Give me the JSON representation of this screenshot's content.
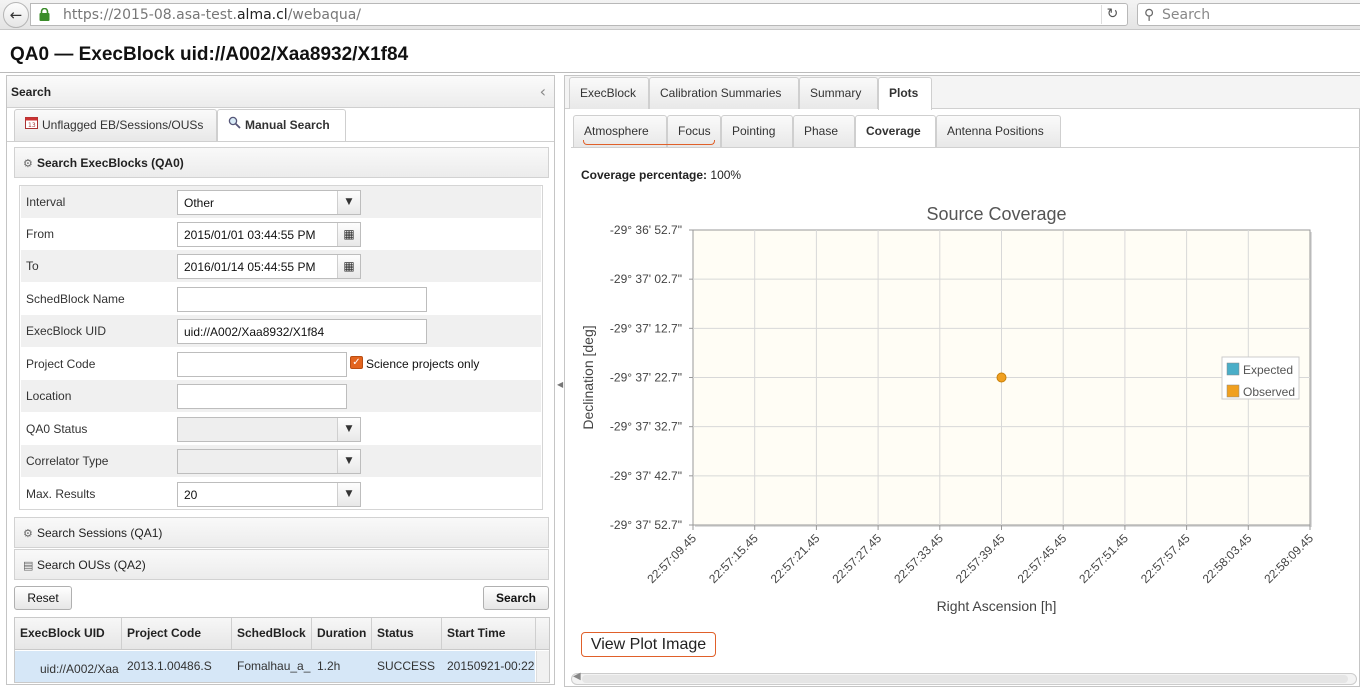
{
  "browser": {
    "url_prefix": "https://2015-08.asa-test.",
    "url_domain": "alma.cl",
    "url_suffix": "/webaqua/",
    "search_placeholder": "Search"
  },
  "page_title": "QA0 — ExecBlock uid://A002/Xaa8932/X1f84",
  "left": {
    "header": "Search",
    "tabs": [
      {
        "label": "Unflagged EB/Sessions/OUSs",
        "icon": "calendar-icon"
      },
      {
        "label": "Manual Search",
        "icon": "magnifier-icon"
      }
    ],
    "sections": {
      "execblocks": "Search ExecBlocks (QA0)",
      "sessions": "Search Sessions (QA1)",
      "ouss": "Search OUSs (QA2)"
    },
    "form": {
      "interval": {
        "label": "Interval",
        "value": "Other"
      },
      "from": {
        "label": "From",
        "value": "2015/01/01 03:44:55 PM"
      },
      "to": {
        "label": "To",
        "value": "2016/01/14 05:44:55 PM"
      },
      "schedblock_name": {
        "label": "SchedBlock Name",
        "value": ""
      },
      "execblock_uid": {
        "label": "ExecBlock UID",
        "value": "uid://A002/Xaa8932/X1f84"
      },
      "project_code": {
        "label": "Project Code",
        "value": "",
        "checkbox_label": "Science projects only",
        "checked": true
      },
      "location": {
        "label": "Location",
        "value": ""
      },
      "qa0_status": {
        "label": "QA0 Status",
        "value": ""
      },
      "correlator_type": {
        "label": "Correlator Type",
        "value": ""
      },
      "max_results": {
        "label": "Max. Results",
        "value": "20"
      }
    },
    "buttons": {
      "reset": "Reset",
      "search": "Search"
    },
    "grid": {
      "columns": [
        "ExecBlock UID",
        "Project Code",
        "SchedBlock",
        "Duration",
        "Status",
        "Start Time"
      ],
      "rows": [
        [
          "uid://A002/Xaa",
          "2013.1.00486.S",
          "Fomalhau_a_",
          "1.2h",
          "SUCCESS",
          "20150921-00:22"
        ]
      ]
    }
  },
  "right": {
    "tabs": [
      "ExecBlock",
      "Calibration Summaries",
      "Summary",
      "Plots"
    ],
    "active_tab": "Plots",
    "subtabs": [
      "Atmosphere",
      "Focus",
      "Pointing",
      "Phase",
      "Coverage",
      "Antenna Positions"
    ],
    "active_subtab": "Coverage",
    "coverage_label": "Coverage percentage:",
    "coverage_value": "100%",
    "view_plot_button": "View Plot Image"
  },
  "colors": {
    "accent_orange": "#e0602a",
    "expected": "#4aaec8",
    "observed": "#f0a020",
    "plot_bg": "#fffdf5"
  },
  "chart_data": {
    "type": "scatter",
    "title": "Source Coverage",
    "xlabel": "Right Ascension [h]",
    "ylabel": "Declination [deg]",
    "x_ticks": [
      "22:57:09.45",
      "22:57:15.45",
      "22:57:21.45",
      "22:57:27.45",
      "22:57:33.45",
      "22:57:39.45",
      "22:57:45.45",
      "22:57:51.45",
      "22:57:57.45",
      "22:58:03.45",
      "22:58:09.45"
    ],
    "y_ticks": [
      "-29° 36' 52.7\"",
      "-29° 37' 02.7\"",
      "-29° 37' 12.7\"",
      "-29° 37' 22.7\"",
      "-29° 37' 32.7\"",
      "-29° 37' 42.7\"",
      "-29° 37' 52.7\""
    ],
    "xlim": [
      "22:57:09.45",
      "22:58:09.45"
    ],
    "ylim": [
      "-29° 37' 52.7\"",
      "-29° 36' 52.7\""
    ],
    "grid": true,
    "legend_position": "right",
    "series": [
      {
        "name": "Expected",
        "points": []
      },
      {
        "name": "Observed",
        "points": [
          {
            "x": "22:57:39.45",
            "y": "-29° 37' 22.7\""
          }
        ]
      }
    ]
  }
}
